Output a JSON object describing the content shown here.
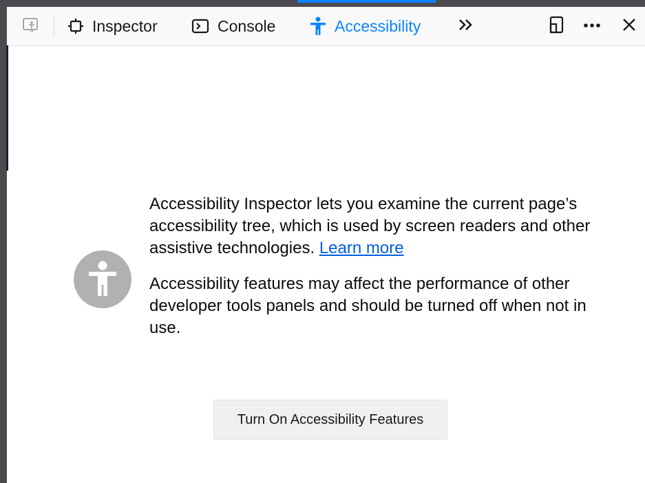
{
  "toolbar": {
    "tabs": [
      {
        "label": "Inspector",
        "icon": "inspector-icon",
        "active": false
      },
      {
        "label": "Console",
        "icon": "console-icon",
        "active": false
      },
      {
        "label": "Accessibility",
        "icon": "accessibility-icon",
        "active": true
      }
    ],
    "overflow_icon": "double-chevron-icon",
    "right_icons": [
      "dock-side-icon",
      "more-options-icon",
      "close-icon"
    ],
    "left_icon": "accessibility-picker-icon"
  },
  "main": {
    "description_part1": "Accessibility Inspector lets you examine the current page’s accessibility tree, which is used by screen readers and other assistive technologies.",
    "learn_more": "Learn more",
    "description_part2": "Accessibility features may affect the performance of other developer tools panels and should be turned off when not in use.",
    "button_label": "Turn On Accessibility Features"
  },
  "colors": {
    "accent": "#0a84ff",
    "link": "#0060df",
    "icon_gray": "#b1b1b3",
    "frame": "#4a4a4f"
  }
}
